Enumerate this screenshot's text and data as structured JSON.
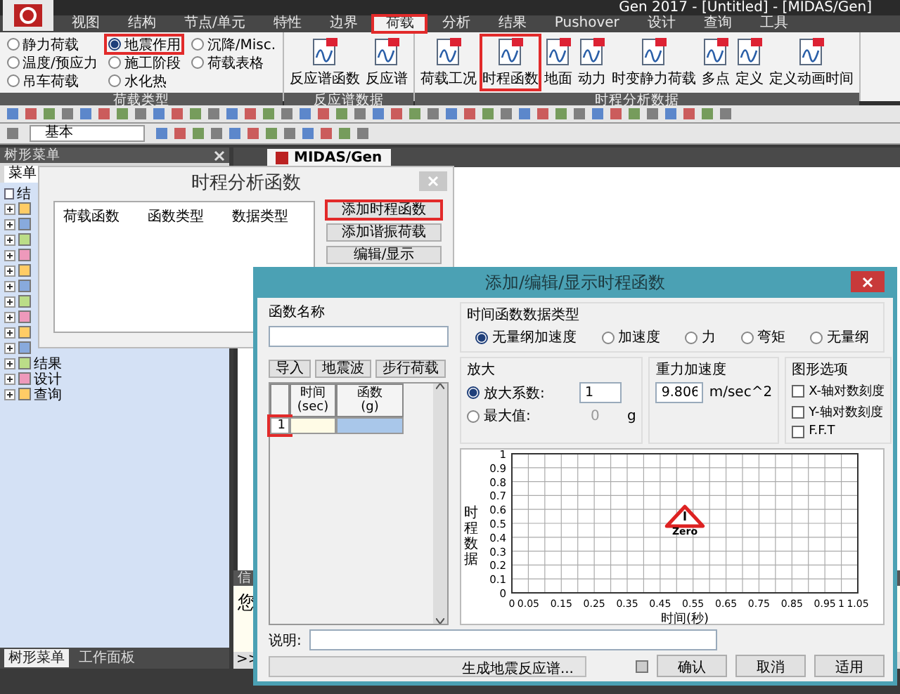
{
  "app": {
    "title": "Gen 2017 - [Untitled] - [MIDAS/Gen]"
  },
  "ribbon_tabs": [
    {
      "label": "视图",
      "selected": false,
      "annotated": false
    },
    {
      "label": "结构",
      "selected": false,
      "annotated": false
    },
    {
      "label": "节点/单元",
      "selected": false,
      "annotated": false
    },
    {
      "label": "特性",
      "selected": false,
      "annotated": false
    },
    {
      "label": "边界",
      "selected": false,
      "annotated": false
    },
    {
      "label": "荷载",
      "selected": true,
      "annotated": true
    },
    {
      "label": "分析",
      "selected": false,
      "annotated": false
    },
    {
      "label": "结果",
      "selected": false,
      "annotated": false
    },
    {
      "label": "Pushover",
      "selected": false,
      "annotated": false
    },
    {
      "label": "设计",
      "selected": false,
      "annotated": false
    },
    {
      "label": "查询",
      "selected": false,
      "annotated": false
    },
    {
      "label": "工具",
      "selected": false,
      "annotated": false
    }
  ],
  "ribbon_groups": [
    {
      "title": "荷载类型",
      "kind": "radios",
      "items": [
        {
          "label": "静力荷载",
          "selected": false,
          "annotated": false
        },
        {
          "label": "温度/预应力",
          "selected": false,
          "annotated": false
        },
        {
          "label": "吊车荷载",
          "selected": false,
          "annotated": false
        },
        {
          "label": "地震作用",
          "selected": true,
          "annotated": true
        },
        {
          "label": "施工阶段",
          "selected": false,
          "annotated": false
        },
        {
          "label": "水化热",
          "selected": false,
          "annotated": false
        },
        {
          "label": "沉降/Misc.",
          "selected": false,
          "annotated": false
        },
        {
          "label": "荷载表格",
          "selected": false,
          "annotated": false
        }
      ]
    },
    {
      "title": "反应谱数据",
      "kind": "buttons",
      "items": [
        {
          "label": "反应谱函数",
          "annotated": false
        },
        {
          "label": "反应谱",
          "annotated": false
        }
      ]
    },
    {
      "title": "时程分析数据",
      "kind": "buttons",
      "items": [
        {
          "label": "荷载工况",
          "annotated": false
        },
        {
          "label": "时程函数",
          "annotated": true
        },
        {
          "label": "地面",
          "annotated": false
        },
        {
          "label": "动力",
          "annotated": false
        },
        {
          "label": "时变静力荷载",
          "annotated": false
        },
        {
          "label": "多点",
          "annotated": false
        },
        {
          "label": "定义",
          "annotated": false
        },
        {
          "label": "定义动画时间",
          "annotated": false
        }
      ]
    }
  ],
  "toolbar": {
    "view_select": "基本"
  },
  "tree_panel": {
    "title": "树形菜单",
    "tab": "菜单",
    "items": [
      {
        "label": "结",
        "kind": "root"
      },
      {
        "expanded": false
      },
      {
        "expanded": false
      },
      {
        "expanded": false
      },
      {
        "expanded": false
      },
      {
        "expanded": false
      },
      {
        "expanded": false
      },
      {
        "expanded": false
      },
      {
        "expanded": false
      },
      {
        "expanded": false
      },
      {
        "expanded": false
      },
      {
        "label": "结果",
        "expanded": false
      },
      {
        "label": "设计",
        "expanded": false
      },
      {
        "label": "查询",
        "expanded": false
      }
    ],
    "bottom_tabs": [
      {
        "label": "树形菜单",
        "selected": true
      },
      {
        "label": "工作面板",
        "selected": false
      }
    ]
  },
  "document_tab": "MIDAS/Gen",
  "info_panel": {
    "title": "信",
    "text": "您",
    "more": ">>"
  },
  "function_list_dialog": {
    "title": "时程分析函数",
    "columns": [
      "荷载函数",
      "函数类型",
      "数据类型"
    ],
    "buttons": [
      {
        "label": "添加时程函数",
        "annotated": true
      },
      {
        "label": "添加谐振荷载",
        "annotated": false
      },
      {
        "label": "编辑/显示",
        "annotated": false
      }
    ]
  },
  "function_editor": {
    "title": "添加/编辑/显示时程函数",
    "name_label": "函数名称",
    "import_buttons": [
      "导入",
      "地震波",
      "步行荷载"
    ],
    "table": {
      "columns": [
        "时间\n(sec)",
        "函数\n(g)"
      ],
      "rows": [
        {
          "number": "1",
          "annotated": true
        }
      ]
    },
    "data_type": {
      "title": "时间函数数据类型",
      "options": [
        {
          "label": "无量纲加速度",
          "selected": true
        },
        {
          "label": "加速度",
          "selected": false
        },
        {
          "label": "力",
          "selected": false
        },
        {
          "label": "弯矩",
          "selected": false
        },
        {
          "label": "无量纲",
          "selected": false
        }
      ]
    },
    "scale": {
      "title": "放大",
      "options": [
        {
          "label": "放大系数:",
          "selected": true,
          "value": "1"
        },
        {
          "label": "最大值:",
          "selected": false,
          "value": "0",
          "unit": "g"
        }
      ]
    },
    "gravity": {
      "title": "重力加速度",
      "value": "9.806",
      "unit": "m/sec^2"
    },
    "graph_options": {
      "title": "图形选项",
      "options": [
        {
          "label": "X-轴对数刻度",
          "checked": false
        },
        {
          "label": "Y-轴对数刻度",
          "checked": false
        },
        {
          "label": "F.F.T",
          "checked": false
        }
      ]
    },
    "chart_data": {
      "type": "line",
      "xlabel": "时间(秒)",
      "ylabel": "时程数据",
      "xlim": [
        0,
        1.05
      ],
      "ylim": [
        0,
        1
      ],
      "xticks": [
        0,
        0.05,
        0.15,
        0.25,
        0.35,
        0.45,
        0.55,
        0.65,
        0.75,
        0.85,
        0.95,
        1,
        1.05
      ],
      "yticks": [
        0,
        0.1,
        0.2,
        0.3,
        0.4,
        0.5,
        0.6,
        0.7,
        0.8,
        0.9,
        1
      ],
      "grid": true,
      "annotations": [
        "Zero"
      ]
    },
    "description_label": "说明:",
    "spectrum_button": "生成地震反应谱...",
    "action_buttons": [
      "确认",
      "取消",
      "适用"
    ]
  }
}
